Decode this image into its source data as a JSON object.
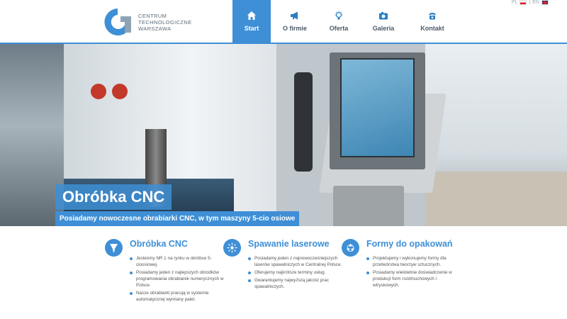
{
  "logo": {
    "lines": [
      "CENTRUM",
      "TECHNOLOGICZNE",
      "WARSZAWA"
    ],
    "color": "#3e8fd6"
  },
  "nav": [
    {
      "label": "Start",
      "icon": "home-icon",
      "active": true
    },
    {
      "label": "O firmie",
      "icon": "megaphone-icon",
      "active": false
    },
    {
      "label": "Oferta",
      "icon": "lightbulb-icon",
      "active": false
    },
    {
      "label": "Galeria",
      "icon": "camera-icon",
      "active": false
    },
    {
      "label": "Kontakt",
      "icon": "phone-icon",
      "active": false
    }
  ],
  "lang": {
    "pl": "PL",
    "en": "EN"
  },
  "hero": {
    "title": "Obróbka CNC",
    "subtitle": "Posiadamy nowoczesne obrabiarki CNC, w tym maszyny 5-cio osiowe",
    "slides_total": 8,
    "slide_active": 1
  },
  "features": [
    {
      "title": "Obróbka CNC",
      "icon": "mill-icon",
      "items": [
        "Jesteśmy NR 1 na rynku w obróbce 5-cioosiowej.",
        "Posiadamy jeden z najlepszych obrodków programowania obrabiarek numerycznych w Polsce.",
        "Nasze obrabiarki pracują w systemie automatycznej wymiany palet."
      ]
    },
    {
      "title": "Spawanie laserowe",
      "icon": "laser-icon",
      "items": [
        "Posiadamy jeden z najnowocześniejszych laserów spawalniczych w Centralnej Polsce.",
        "Oferujemy najkrótsze terminy usług.",
        "Gwarantujemy najwyższą jakość prac spawalniczych."
      ]
    },
    {
      "title": "Formy do opakowań",
      "icon": "recycle-icon",
      "items": [
        "Projektujemy i wykonujemy formy dla przetwórstwa tworzyw sztucznych.",
        "Posiadamy wieloletnie doświadczenie w produkcji form rozdmuchowych i wtryskowych."
      ]
    }
  ]
}
